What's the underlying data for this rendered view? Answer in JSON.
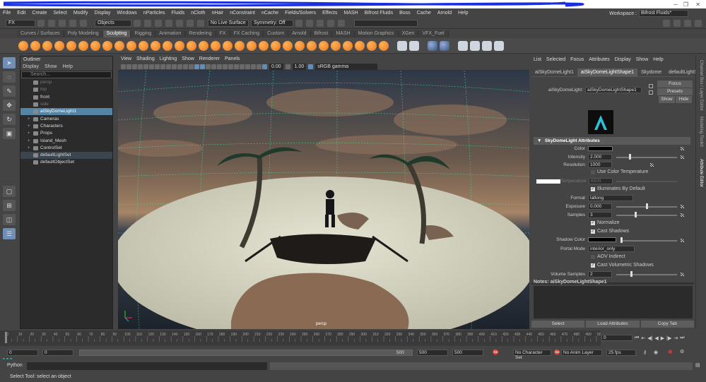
{
  "colors": {
    "accent": "#5285a6",
    "shelf_orange": "#e8731a",
    "bg": "#444444"
  },
  "menubar": {
    "items": [
      "File",
      "Edit",
      "Create",
      "Select",
      "Modify",
      "Display",
      "Windows",
      "nParticles",
      "Fluids",
      "nCloth",
      "nHair",
      "nConstraint",
      "nCache",
      "Fields/Solvers",
      "Effects",
      "MASH",
      "Bifrost Fluids",
      "Boss",
      "Cache",
      "Arnold",
      "Help"
    ]
  },
  "workspace": {
    "label": "Workspace :",
    "value": "Bifrost Fluids*"
  },
  "statusline": {
    "menuset": "FX",
    "objects": "Objects",
    "live": "No Live Surface",
    "symmetry": "Symmetry: Off"
  },
  "shelf": {
    "tabs": [
      "Curves / Surfaces",
      "Poly Modeling",
      "Sculpting",
      "Rigging",
      "Animation",
      "Rendering",
      "FX",
      "FX Caching",
      "Custom",
      "Arnold",
      "Bifrost",
      "MASH",
      "Motion Graphics",
      "XGen",
      "VFX_Fuel"
    ],
    "active": "Sculpting"
  },
  "outliner": {
    "title": "Outliner",
    "menu": [
      "Display",
      "Show",
      "Help"
    ],
    "search_placeholder": "Search...",
    "items": [
      {
        "label": "persp",
        "state": "dim",
        "exp": ""
      },
      {
        "label": "top",
        "state": "dim",
        "exp": ""
      },
      {
        "label": "front",
        "state": "",
        "exp": ""
      },
      {
        "label": "side",
        "state": "dim",
        "exp": ""
      },
      {
        "label": "aiSkyDomeLight1",
        "state": "sel",
        "exp": ""
      },
      {
        "label": "Cameras",
        "state": "",
        "exp": "+"
      },
      {
        "label": "Characters",
        "state": "",
        "exp": "+"
      },
      {
        "label": "Props",
        "state": "",
        "exp": "+"
      },
      {
        "label": "Island_Mesh",
        "state": "",
        "exp": "+"
      },
      {
        "label": "ControlSet",
        "state": "",
        "exp": "+"
      },
      {
        "label": "defaultLightSet",
        "state": "hl",
        "exp": ""
      },
      {
        "label": "defaultObjectSet",
        "state": "",
        "exp": ""
      }
    ]
  },
  "viewport": {
    "menu": [
      "View",
      "Shading",
      "Lighting",
      "Show",
      "Renderer",
      "Panels"
    ],
    "exposure": "0.00",
    "gamma": "1.00",
    "colorspace": "sRGB gamma",
    "camera": "persp"
  },
  "ae": {
    "menu": [
      "List",
      "Selected",
      "Focus",
      "Attributes",
      "Display",
      "Show",
      "Help"
    ],
    "tabs": [
      "aiSkyDomeLight1",
      "aiSkyDomeLightShape1",
      "Skydome",
      "defaultLightSet"
    ],
    "active_tab": "aiSkyDomeLightShape1",
    "node_label": "aiSkyDomeLight:",
    "node_value": "aiSkyDomeLightShape1",
    "focus": "Focus",
    "presets": "Presets",
    "show": "Show",
    "hide": "Hide",
    "section": "SkyDomeLight Attributes",
    "color_label": "Color",
    "intensity_label": "Intensity",
    "intensity": "2.000",
    "resolution_label": "Resolution",
    "resolution": "1000",
    "use_color_temp": "Use Color Temperature",
    "temperature_label": "Temperature",
    "temperature": "6500",
    "illuminates": "Illuminates By Default",
    "format_label": "Format",
    "format": "latlong",
    "exposure_label": "Exposure",
    "exposure": "0.000",
    "samples_label": "Samples",
    "samples": "3",
    "normalize": "Normalize",
    "cast_shadows": "Cast Shadows",
    "shadow_color_label": "Shadow Color",
    "portal_label": "Portal Mode",
    "portal": "interior_only",
    "aov": "AOV Indirect",
    "cast_vol": "Cast Volumetric Shadows",
    "vol_samples_label": "Volume Samples",
    "vol_samples": "2",
    "notes": "Notes:  aiSkyDomeLightShape1",
    "btn_select": "Select",
    "btn_load": "Load Attributes",
    "btn_copy": "Copy Tab"
  },
  "rstrip": {
    "items": [
      "Channel Box / Layer Editor",
      "Modeling Toolkit",
      "Attribute Editor"
    ]
  },
  "timeslider": {
    "ticks": [
      "0",
      "5",
      "10",
      "15",
      "20",
      "25",
      "30",
      "35",
      "40",
      "45",
      "50",
      "55",
      "60",
      "65",
      "70",
      "75",
      "80",
      "85",
      "90",
      "95",
      "100",
      "105",
      "110",
      "115",
      "120",
      "125",
      "130",
      "135",
      "140",
      "145",
      "150",
      "155",
      "160",
      "165",
      "170",
      "175",
      "180",
      "185",
      "190",
      "195",
      "200",
      "205",
      "210",
      "215",
      "220",
      "225",
      "230",
      "235",
      "240",
      "245",
      "250",
      "255",
      "260",
      "265",
      "270",
      "275",
      "280",
      "285",
      "290",
      "295",
      "300",
      "305",
      "310",
      "315",
      "320",
      "325",
      "330",
      "335",
      "340",
      "345",
      "350",
      "355",
      "360",
      "365",
      "370",
      "375",
      "380",
      "385",
      "390",
      "395",
      "400",
      "405",
      "410",
      "415",
      "420",
      "425",
      "430",
      "435",
      "440",
      "445",
      "450",
      "455",
      "460",
      "465",
      "470",
      "475",
      "480",
      "485",
      "490",
      "495",
      "500"
    ],
    "current": "0"
  },
  "range": {
    "start": "0",
    "inner_start": "0",
    "inner_end": "500",
    "end": "500",
    "end2": "500",
    "character": "No Character Set",
    "anim_layer": "No Anim Layer",
    "fps": "25 fps"
  },
  "cmd": {
    "label": "Python"
  },
  "help": {
    "text": "Select Tool: select an object"
  }
}
